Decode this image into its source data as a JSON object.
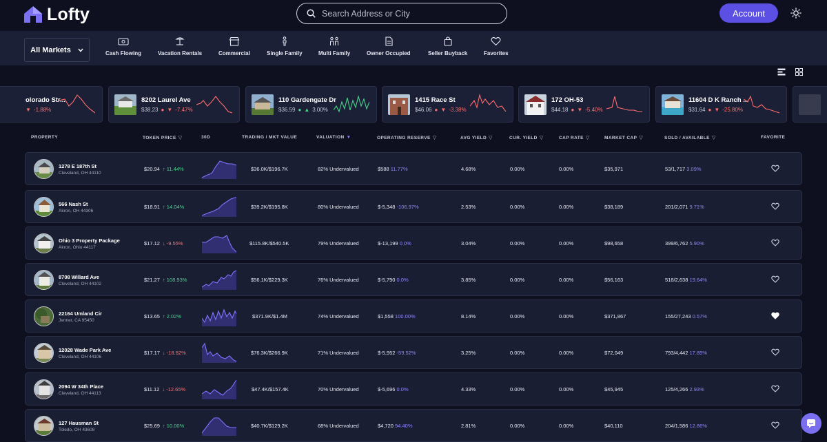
{
  "header": {
    "brand": "Lofty",
    "search_placeholder": "Search Address or City",
    "account_label": "Account"
  },
  "market": {
    "selected": "All Markets"
  },
  "categories": [
    {
      "label": "Cash Flowing",
      "icon": "cash-icon"
    },
    {
      "label": "Vacation Rentals",
      "icon": "vacation-icon"
    },
    {
      "label": "Commercial",
      "icon": "store-icon"
    },
    {
      "label": "Single Family",
      "icon": "person-icon"
    },
    {
      "label": "Multi Family",
      "icon": "family-icon"
    },
    {
      "label": "Owner Occupied",
      "icon": "document-icon"
    },
    {
      "label": "Seller Buyback",
      "icon": "bag-icon"
    },
    {
      "label": "Favorites",
      "icon": "heart-icon"
    }
  ],
  "carousel": [
    {
      "address": "olorado Str...",
      "price": "",
      "change": "-1.88%",
      "trend": "down"
    },
    {
      "address": "8202 Laurel Ave",
      "price": "$38.23",
      "change": "-7.47%",
      "trend": "down"
    },
    {
      "address": "110 Gardengate Dr",
      "price": "$36.59",
      "change": "3.00%",
      "trend": "up"
    },
    {
      "address": "1415 Race St",
      "price": "$46.06",
      "change": "-3.38%",
      "trend": "down"
    },
    {
      "address": "172 OH-53",
      "price": "$44.18",
      "change": "-5.40%",
      "trend": "down"
    },
    {
      "address": "11604 D K Ranch ...",
      "price": "$31.64",
      "change": "-25.80%",
      "trend": "down"
    }
  ],
  "table": {
    "headers": {
      "property": "PROPERTY",
      "token_price": "TOKEN PRICE",
      "d30": "30D",
      "trading": "TRADING / MKT VALUE",
      "valuation": "VALUATION",
      "reserve": "OPERATING RESERVE",
      "avg_yield": "AVG YIELD",
      "cur_yield": "CUR. YIELD",
      "cap_rate": "CAP RATE",
      "market_cap": "MARKET CAP",
      "sold": "SOLD / AVAILABLE",
      "favorite": "FAVORITE"
    },
    "rows": [
      {
        "name": "1278 E 187th St",
        "city": "Cleveland, OH 44110",
        "price": "$20.94",
        "chg": "11.44%",
        "dir": "up",
        "trading": "$36.0K/$196.7K",
        "valuation": "82% Undervalued",
        "reserve": "$588",
        "reserve_pct": "11.77%",
        "avg_yield": "4.68%",
        "cur_yield": "0.00%",
        "cap_rate": "0.00%",
        "market_cap": "$35,971",
        "sold": "53/1,717",
        "sold_pct": "3.09%",
        "favorite": false
      },
      {
        "name": "566 Nash St",
        "city": "Akron, OH 44306",
        "price": "$18.91",
        "chg": "14.04%",
        "dir": "up",
        "trading": "$39.2K/$195.8K",
        "valuation": "80% Undervalued",
        "reserve": "$-5,348",
        "reserve_pct": "-106.97%",
        "avg_yield": "2.53%",
        "cur_yield": "0.00%",
        "cap_rate": "0.00%",
        "market_cap": "$38,189",
        "sold": "201/2,071",
        "sold_pct": "9.71%",
        "favorite": false
      },
      {
        "name": "Ohio 3 Property Package",
        "city": "Akron, Ohio 44117",
        "price": "$17.12",
        "chg": "-9.55%",
        "dir": "down",
        "trading": "$115.8K/$540.5K",
        "valuation": "79% Undervalued",
        "reserve": "$-13,199",
        "reserve_pct": "0.0%",
        "avg_yield": "3.04%",
        "cur_yield": "0.00%",
        "cap_rate": "0.00%",
        "market_cap": "$98,658",
        "sold": "399/6,762",
        "sold_pct": "5.90%",
        "favorite": false
      },
      {
        "name": "8708 Willard Ave",
        "city": "Cleveland, OH 44102",
        "price": "$21.27",
        "chg": "108.93%",
        "dir": "up",
        "trading": "$56.1K/$229.3K",
        "valuation": "76% Undervalued",
        "reserve": "$-5,790",
        "reserve_pct": "0.0%",
        "avg_yield": "3.85%",
        "cur_yield": "0.00%",
        "cap_rate": "0.00%",
        "market_cap": "$56,163",
        "sold": "518/2,638",
        "sold_pct": "19.64%",
        "favorite": false
      },
      {
        "name": "22164 Umland Cir",
        "city": "Jenner, CA 95450",
        "price": "$13.65",
        "chg": "2.02%",
        "dir": "up",
        "trading": "$371.9K/$1.4M",
        "valuation": "74% Undervalued",
        "reserve": "$1,558",
        "reserve_pct": "100.00%",
        "avg_yield": "8.14%",
        "cur_yield": "0.00%",
        "cap_rate": "0.00%",
        "market_cap": "$371,867",
        "sold": "155/27,243",
        "sold_pct": "0.57%",
        "favorite": true
      },
      {
        "name": "12028 Wade Park Ave",
        "city": "Cleveland, OH 44106",
        "price": "$17.17",
        "chg": "-18.82%",
        "dir": "down",
        "trading": "$76.3K/$266.9K",
        "valuation": "71% Undervalued",
        "reserve": "$-5,952",
        "reserve_pct": "-59.52%",
        "avg_yield": "3.25%",
        "cur_yield": "0.00%",
        "cap_rate": "0.00%",
        "market_cap": "$72,049",
        "sold": "793/4,442",
        "sold_pct": "17.85%",
        "favorite": false
      },
      {
        "name": "2094 W 34th Place",
        "city": "Cleveland, OH 44113",
        "price": "$11.12",
        "chg": "-12.65%",
        "dir": "down",
        "trading": "$47.4K/$157.4K",
        "valuation": "70% Undervalued",
        "reserve": "$-5,696",
        "reserve_pct": "0.0%",
        "avg_yield": "4.33%",
        "cur_yield": "0.00%",
        "cap_rate": "0.00%",
        "market_cap": "$45,945",
        "sold": "125/4,266",
        "sold_pct": "2.93%",
        "favorite": false
      },
      {
        "name": "127 Hausman St",
        "city": "Toledo, OH 43608",
        "price": "$25.69",
        "chg": "10.00%",
        "dir": "up",
        "trading": "$40.7K/$129.2K",
        "valuation": "68% Undervalued",
        "reserve": "$4,720",
        "reserve_pct": "94.40%",
        "avg_yield": "2.81%",
        "cur_yield": "0.00%",
        "cap_rate": "0.00%",
        "market_cap": "$40,110",
        "sold": "204/1,586",
        "sold_pct": "12.86%",
        "favorite": false
      }
    ]
  },
  "colors": {
    "accent": "#5b4fe4",
    "positive": "#46d48c",
    "negative": "#ff6d6d",
    "link": "#8e86ff"
  }
}
